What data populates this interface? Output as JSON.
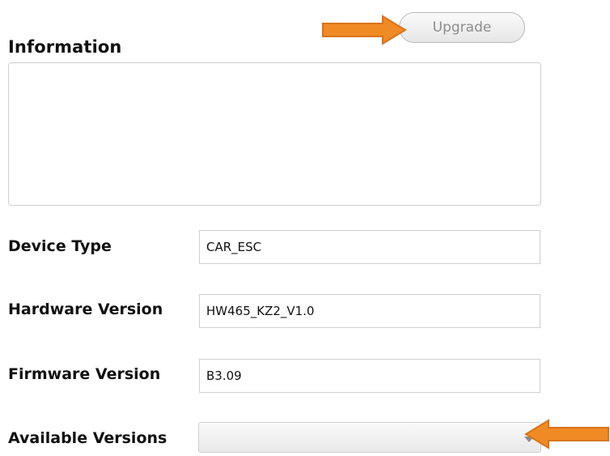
{
  "information": {
    "title": "Information",
    "content": ""
  },
  "toolbar": {
    "upgrade_label": "Upgrade"
  },
  "fields": {
    "device_type": {
      "label": "Device Type",
      "value": "CAR_ESC"
    },
    "hardware_version": {
      "label": "Hardware Version",
      "value": "HW465_KZ2_V1.0"
    },
    "firmware_version": {
      "label": "Firmware Version",
      "value": "B3.09"
    },
    "available_versions": {
      "label": "Available Versions",
      "selected": ""
    }
  },
  "colors": {
    "arrow": "#f08a24",
    "arrow_stroke": "#d8741c"
  },
  "icons": {
    "annotation_arrow": "right-arrow-icon",
    "dropdown_caret": "chevron-down-icon"
  }
}
